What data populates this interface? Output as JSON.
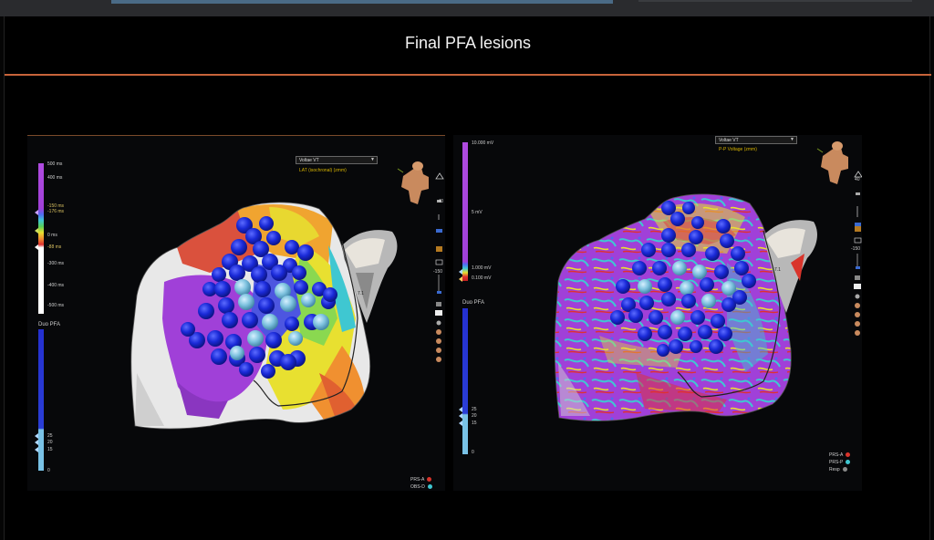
{
  "slide": {
    "title": "Final PFA lesions"
  },
  "left_panel": {
    "map_select": "Voltae VT",
    "map_subtitle": "LAT (isochronal) (zmm)",
    "scale_labels": [
      "500 ms",
      "400 ms",
      "-150 ms",
      "-176 ms",
      "0 ms",
      "-88 ms",
      "-300 ms",
      "-400 ms",
      "-500 ms"
    ],
    "ablation_label": "Duo PFA",
    "ablation_scale": [
      "25",
      "20",
      "15",
      "0"
    ],
    "right_tool_value_1": "40",
    "right_tool_value_2": "-150",
    "contour_label": "7.1",
    "legend": [
      {
        "label": "PRS-A",
        "color": "#d9342b"
      },
      {
        "label": "OBS-D",
        "color": "#3fc7d1"
      }
    ]
  },
  "right_panel": {
    "map_select": "Voltae VT",
    "map_subtitle": "P-P Voltage (zmm)",
    "scale_labels": [
      "10.000 mV",
      "5 mV",
      "1.000 mV",
      "0.100 mV"
    ],
    "ablation_label": "Duo PFA",
    "ablation_scale": [
      "25",
      "20",
      "15",
      "0"
    ],
    "right_tool_value_1": "40",
    "right_tool_value_2": "-150",
    "contour_label": "7.1",
    "legend": [
      {
        "label": "PRS-A",
        "color": "#d9342b"
      },
      {
        "label": "PRS-P",
        "color": "#3fc7d1"
      },
      {
        "label": "Resp",
        "color": "#8a8a8a"
      }
    ]
  },
  "colors": {
    "accent_rule": "#c8643a",
    "lesion_dark": "#1a2ad8",
    "lesion_light": "#7fc3e0",
    "purple_scale": "#a040d8",
    "ablation_scale": "#2430d0"
  }
}
